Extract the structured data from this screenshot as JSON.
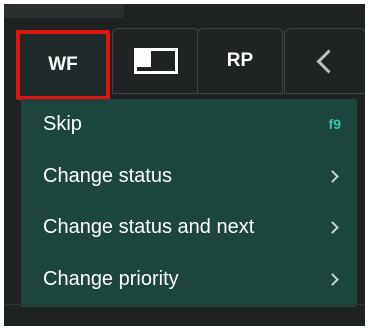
{
  "toolbar": {
    "tabs": [
      {
        "label": "WF",
        "icon": null
      },
      {
        "label": "",
        "icon": "layout-panel-icon"
      },
      {
        "label": "RP",
        "icon": null
      },
      {
        "label": "",
        "icon": "chevron-left-icon"
      }
    ]
  },
  "menu": {
    "items": [
      {
        "label": "Skip",
        "shortcut": "f9",
        "submenu": false
      },
      {
        "label": "Change status",
        "shortcut": "",
        "submenu": true
      },
      {
        "label": "Change status and next",
        "shortcut": "",
        "submenu": true
      },
      {
        "label": "Change priority",
        "shortcut": "",
        "submenu": true
      }
    ]
  },
  "colors": {
    "background": "#1e2222",
    "menu_background": "#1d443d",
    "highlight_border": "#e11414",
    "shortcut_text": "#33c7a8"
  }
}
